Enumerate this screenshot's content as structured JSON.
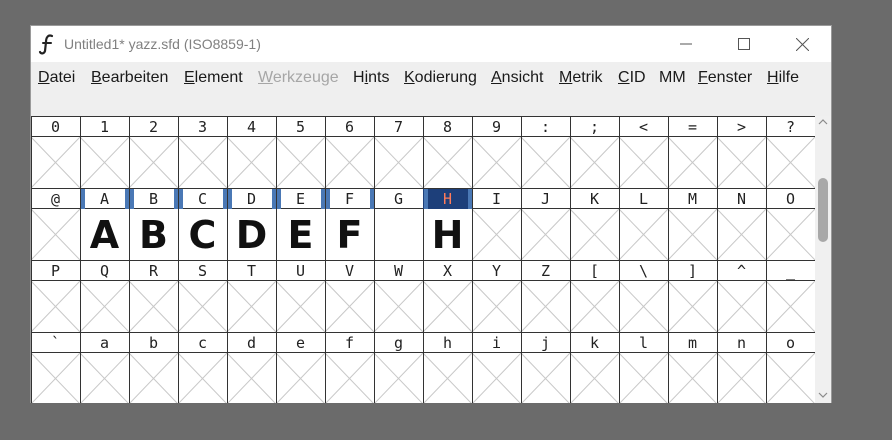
{
  "window": {
    "title": "Untitled1*  yazz.sfd (ISO8859-1)",
    "minimize_symbol": "minimize",
    "maximize_symbol": "maximize",
    "close_symbol": "close"
  },
  "menu": [
    {
      "pre": "",
      "mn": "D",
      "post": "atei",
      "disabled": false
    },
    {
      "pre": "",
      "mn": "B",
      "post": "earbeiten",
      "disabled": false
    },
    {
      "pre": "",
      "mn": "E",
      "post": "lement",
      "disabled": false
    },
    {
      "pre": "",
      "mn": "W",
      "post": "erkzeuge",
      "disabled": true
    },
    {
      "pre": "H",
      "mn": "i",
      "post": "nts",
      "disabled": false
    },
    {
      "pre": "",
      "mn": "K",
      "post": "odierung",
      "disabled": false
    },
    {
      "pre": "",
      "mn": "A",
      "post": "nsicht",
      "disabled": false
    },
    {
      "pre": "",
      "mn": "M",
      "post": "etrik",
      "disabled": false
    },
    {
      "pre": "",
      "mn": "C",
      "post": "ID",
      "disabled": false
    },
    {
      "pre": "MM",
      "mn": "",
      "post": "",
      "disabled": false
    },
    {
      "pre": "",
      "mn": "F",
      "post": "enster",
      "disabled": false
    },
    {
      "pre": "",
      "mn": "H",
      "post": "ilfe",
      "disabled": false
    }
  ],
  "font_view": {
    "rows": [
      [
        "0",
        "1",
        "2",
        "3",
        "4",
        "5",
        "6",
        "7",
        "8",
        "9",
        ":",
        ";",
        "<",
        "=",
        ">",
        "?"
      ],
      [
        "@",
        "A",
        "B",
        "C",
        "D",
        "E",
        "F",
        "G",
        "H",
        "I",
        "J",
        "K",
        "L",
        "M",
        "N",
        "O"
      ],
      [
        "P",
        "Q",
        "R",
        "S",
        "T",
        "U",
        "V",
        "W",
        "X",
        "Y",
        "Z",
        "[",
        "\\",
        "]",
        "^",
        "_"
      ],
      [
        "`",
        "a",
        "b",
        "c",
        "d",
        "e",
        "f",
        "g",
        "h",
        "i",
        "j",
        "k",
        "l",
        "m",
        "n",
        "o"
      ]
    ],
    "glyphs_present": {
      "1": {
        "A": "A",
        "B": "B",
        "C": "C",
        "D": "D",
        "E": "E",
        "F": "F",
        "H": "H"
      }
    },
    "selected": "H",
    "modified_markers": [
      "A",
      "B",
      "C",
      "D",
      "E",
      "F",
      "H"
    ]
  },
  "colors": {
    "selection": "#1d3f7a",
    "selected_label_text": "#ff7b5a",
    "changed_marker": "#4a78b5",
    "empty_cross": "#c8c8c8"
  }
}
